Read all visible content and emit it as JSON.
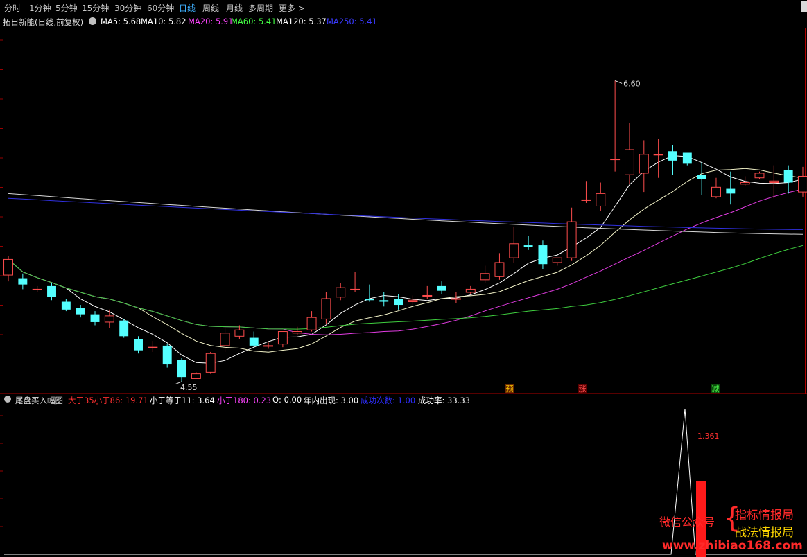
{
  "toolbar": {
    "periods": [
      "分时",
      "1分钟",
      "5分钟",
      "15分钟",
      "30分钟",
      "60分钟",
      "日线",
      "周线",
      "月线",
      "多周期",
      "更多 >"
    ],
    "active": "日线"
  },
  "info": {
    "stock_title": "拓日新能(日线,前复权)",
    "ma": [
      {
        "label": "MA5: 5.68",
        "color": "#ffffff"
      },
      {
        "label": "MA10: 5.82",
        "color": "#ffffff"
      },
      {
        "label": "MA20: 5.91",
        "color": "#ff44ff"
      },
      {
        "label": "MA60: 5.41",
        "color": "#44ff44"
      },
      {
        "label": "MA120: 5.37",
        "color": "#ffffff"
      },
      {
        "label": "MA250: 5.41",
        "color": "#3a3aff"
      }
    ]
  },
  "sub": {
    "title": "尾盘买入幅图",
    "items": [
      {
        "label": "大于35小于86: 19.71",
        "color": "#ff3030"
      },
      {
        "label": "小于等于11: 3.64",
        "color": "#ffffff"
      },
      {
        "label": "小于180: 0.23",
        "color": "#ff44ff"
      },
      {
        "label": "Q: 0.00",
        "color": "#ffffff"
      },
      {
        "label": "年内出现: 3.00",
        "color": "#ffffff"
      },
      {
        "label": "成功次数: 1.00",
        "color": "#2e2eff"
      },
      {
        "label": "成功率: 33.33",
        "color": "#ffffff"
      }
    ],
    "value_label": "1.361"
  },
  "markers": {
    "yu": "预",
    "zhang": "涨",
    "jian": "减"
  },
  "watermark": {
    "left": "微信公众号",
    "right1": "指标情报局",
    "right2": "战法情报局",
    "url": "www.zhibiao168.com"
  },
  "chart_data": {
    "type": "candlestick",
    "high_label": "6.60",
    "low_label": "4.55",
    "ohlc": [
      [
        5.12,
        5.22,
        5.08,
        5.24
      ],
      [
        5.1,
        5.06,
        5.03,
        5.13
      ],
      [
        5.03,
        5.03,
        5.01,
        5.05
      ],
      [
        5.05,
        4.98,
        4.96,
        5.07
      ],
      [
        4.95,
        4.9,
        4.89,
        4.97
      ],
      [
        4.91,
        4.87,
        4.85,
        4.93
      ],
      [
        4.87,
        4.82,
        4.8,
        4.89
      ],
      [
        4.82,
        4.86,
        4.78,
        4.9
      ],
      [
        4.83,
        4.73,
        4.72,
        4.84
      ],
      [
        4.71,
        4.64,
        4.62,
        4.73
      ],
      [
        4.66,
        4.66,
        4.63,
        4.7
      ],
      [
        4.67,
        4.55,
        4.53,
        4.68
      ],
      [
        4.58,
        4.47,
        4.44,
        4.59
      ],
      [
        4.46,
        4.49,
        4.46,
        4.5
      ],
      [
        4.5,
        4.62,
        4.49,
        4.63
      ],
      [
        4.67,
        4.75,
        4.63,
        4.78
      ],
      [
        4.73,
        4.77,
        4.71,
        4.8
      ],
      [
        4.72,
        4.67,
        4.66,
        4.76
      ],
      [
        4.67,
        4.67,
        4.65,
        4.69
      ],
      [
        4.68,
        4.76,
        4.66,
        4.76
      ],
      [
        4.75,
        4.76,
        4.74,
        4.79
      ],
      [
        4.77,
        4.85,
        4.76,
        4.89
      ],
      [
        4.84,
        4.97,
        4.81,
        5.01
      ],
      [
        4.98,
        5.04,
        4.96,
        5.07
      ],
      [
        5.03,
        5.03,
        5.01,
        5.14
      ],
      [
        4.97,
        4.96,
        4.95,
        5.06
      ],
      [
        4.96,
        4.95,
        4.92,
        5.01
      ],
      [
        4.97,
        4.93,
        4.9,
        5.0
      ],
      [
        4.95,
        4.96,
        4.93,
        4.99
      ],
      [
        4.99,
        4.99,
        4.97,
        5.05
      ],
      [
        5.05,
        5.02,
        5.0,
        5.08
      ],
      [
        4.97,
        4.97,
        4.94,
        5.01
      ],
      [
        5.01,
        5.03,
        5.0,
        5.05
      ],
      [
        5.09,
        5.13,
        5.07,
        5.18
      ],
      [
        5.11,
        5.2,
        5.09,
        5.26
      ],
      [
        5.23,
        5.32,
        5.2,
        5.43
      ],
      [
        5.31,
        5.3,
        5.28,
        5.37
      ],
      [
        5.31,
        5.19,
        5.16,
        5.34
      ],
      [
        5.2,
        5.23,
        5.18,
        5.23
      ],
      [
        5.23,
        5.46,
        5.21,
        5.55
      ],
      [
        5.6,
        5.6,
        5.58,
        5.72
      ],
      [
        5.56,
        5.64,
        5.53,
        5.71
      ],
      [
        5.86,
        5.86,
        5.78,
        6.36
      ],
      [
        5.76,
        5.92,
        5.7,
        6.09
      ],
      [
        5.77,
        5.89,
        5.65,
        5.98
      ],
      [
        5.89,
        5.89,
        5.74,
        5.99
      ],
      [
        5.91,
        5.85,
        5.76,
        5.95
      ],
      [
        5.9,
        5.83,
        5.82,
        5.83
      ],
      [
        5.76,
        5.73,
        5.63,
        5.84
      ],
      [
        5.62,
        5.68,
        5.61,
        5.74
      ],
      [
        5.67,
        5.64,
        5.57,
        5.78
      ],
      [
        5.7,
        5.71,
        5.69,
        5.75
      ],
      [
        5.74,
        5.77,
        5.73,
        5.78
      ],
      [
        5.71,
        5.72,
        5.61,
        5.82
      ],
      [
        5.79,
        5.71,
        5.64,
        5.82
      ],
      [
        5.65,
        5.75,
        5.62,
        5.81
      ]
    ]
  }
}
